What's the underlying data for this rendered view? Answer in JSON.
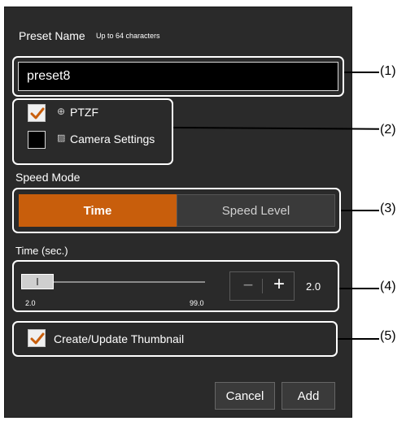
{
  "preset_name": {
    "label": "Preset Name",
    "hint": "Up to 64 characters",
    "value": "preset8"
  },
  "targets": [
    {
      "label": "PTZF",
      "checked": true,
      "icon": "ptzf-icon"
    },
    {
      "label": "Camera Settings",
      "checked": false,
      "icon": "camera-settings-icon"
    }
  ],
  "speed_mode": {
    "label": "Speed Mode",
    "options": [
      "Time",
      "Speed Level"
    ],
    "selected": "Time"
  },
  "time": {
    "label": "Time (sec.)",
    "min_label": "2.0",
    "max_label": "99.0",
    "value": "2.0",
    "value_number": 2.0,
    "min": 2.0,
    "max": 99.0,
    "minus_symbol": "−",
    "plus_symbol": "+"
  },
  "thumbnail": {
    "label": "Create/Update Thumbnail",
    "checked": true
  },
  "buttons": {
    "cancel": "Cancel",
    "add": "Add"
  },
  "callouts": [
    "(1)",
    "(2)",
    "(3)",
    "(4)",
    "(5)"
  ],
  "colors": {
    "panel": "#2a2a2a",
    "accent": "#c85e0c",
    "input_bg": "#000000"
  }
}
